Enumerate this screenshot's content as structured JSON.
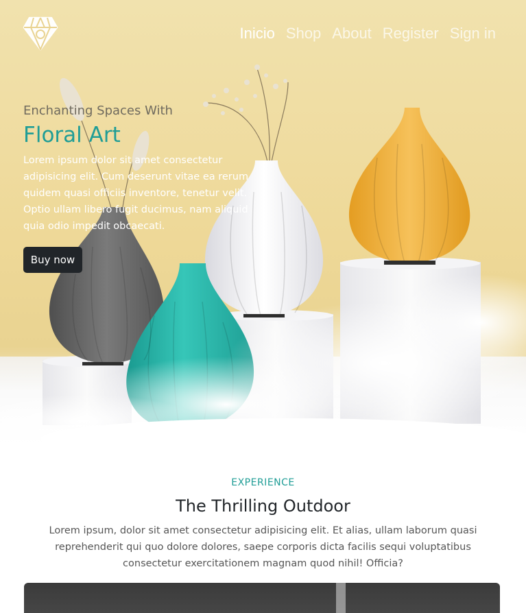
{
  "nav": {
    "logo_icon": "diamond-icon",
    "links": [
      "Inicio",
      "Shop",
      "About",
      "Register",
      "Sign in"
    ],
    "active_index": 0
  },
  "hero": {
    "subtitle": "Enchanting Spaces With",
    "title": "Floral Art",
    "description": "Lorem ipsum dolor sit amet consectetur adipisicing elit. Cum deserunt vitae ea rerum quidem quasi officiis inventore, tenetur velit. Optio ullam libero fugit ducimus, nam aliquid quia odio impedit obcaecati.",
    "cta": "Buy now"
  },
  "experience": {
    "eyebrow": "EXPERIENCE",
    "title": "The Thrilling Outdoor",
    "description": "Lorem ipsum, dolor sit amet consectetur adipisicing elit. Et alias, ullam laborum quasi reprehenderit qui quo dolore dolores, saepe corporis dicta facilis sequi voluptatibus consectetur exercitationem magnam quod nihil! Officia?"
  },
  "colors": {
    "accent": "#1f9d96",
    "dark": "#212529",
    "hero_bg": "#eed897",
    "vase_gray": "#6b6b6b",
    "vase_teal": "#27b2a6",
    "vase_white": "#ececec",
    "vase_yellow": "#f0b232"
  }
}
